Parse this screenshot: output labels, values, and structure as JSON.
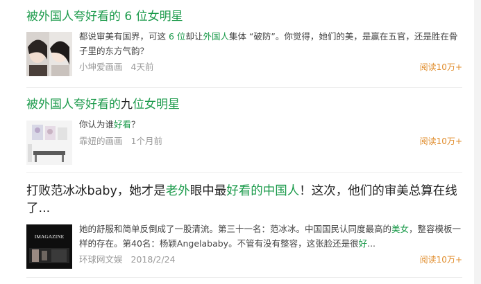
{
  "results": [
    {
      "title_parts": [
        "被外国人夸好看的 ",
        "6",
        " 位女明星"
      ],
      "snippet_parts": [
        "都说审美有国界，可这 ",
        "6 位",
        "却让",
        "外国人",
        "集体 “破防”。你觉得，她们的美，是赢在五官，还是胜在骨子里的东方气韵？"
      ],
      "source": "小坤爱画画",
      "time": "4天前",
      "read_count": "阅读10万+",
      "thumb_icon": "portrait-photo"
    },
    {
      "title_parts": [
        "被外国人夸好看的",
        "九",
        "位女明星"
      ],
      "snippet_parts": [
        "你认为谁",
        "好看",
        "？"
      ],
      "source": "霏妞的画画",
      "time": "1个月前",
      "read_count": "阅读10万+",
      "thumb_icon": "room-photo"
    },
    {
      "title_parts": [
        "打败范冰冰baby，她才是",
        "老外",
        "眼中最",
        "好看的",
        "中国人",
        "！这次，他们的审美总算在线了..."
      ],
      "snippet_parts": [
        "她的舒服和简单反倒成了一股清流。第三十一名：范冰冰。中国国民认同度最高的",
        "美女",
        "，整容模板一样的存在。第40名：杨颖Angelababy。不管有没有整容，这张脸还是很",
        "好",
        "..."
      ],
      "source": "环球网文娱",
      "time": "2018/2/24",
      "read_count": "阅读10万+",
      "thumb_icon": "magazine-cover",
      "thumb_text": "IMAGAZINE"
    }
  ]
}
